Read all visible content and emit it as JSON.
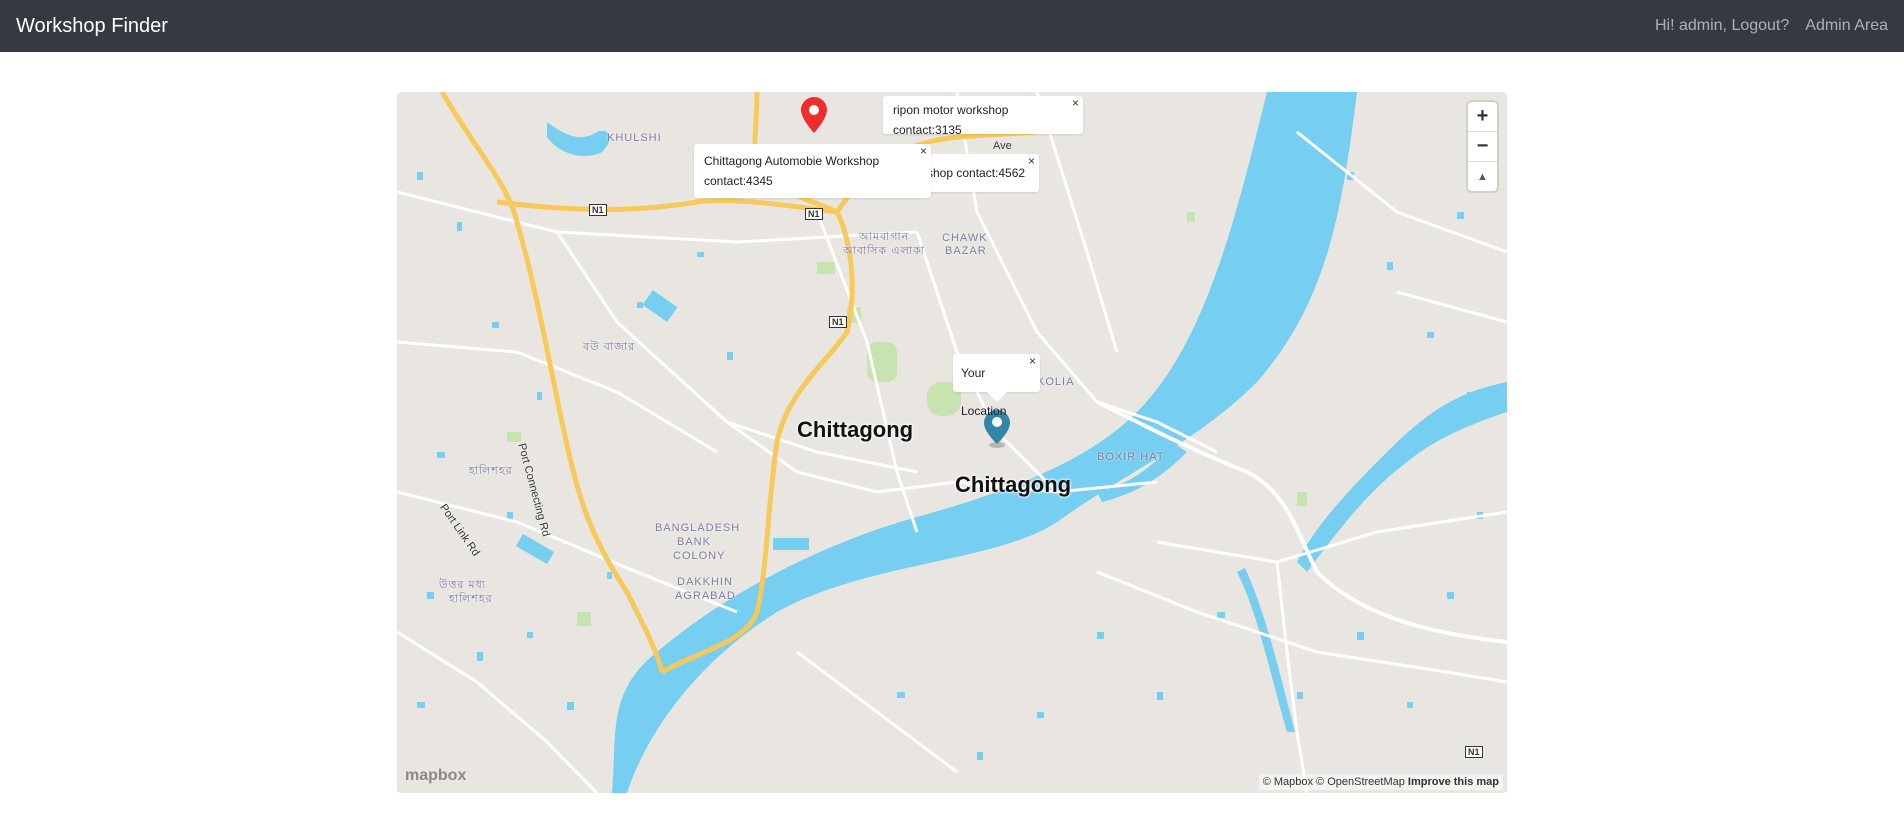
{
  "navbar": {
    "brand": "Workshop Finder",
    "greeting": "Hi! admin, Logout?",
    "admin_link": "Admin Area"
  },
  "map": {
    "controls": {
      "zoom_in": "+",
      "zoom_out": "−",
      "compass": "▲"
    },
    "popups": {
      "ripon": "ripon motor workshop contact:3135",
      "automobile_line1": "Chittagong Automobie Workshop",
      "automobile_line2": "contact:4345",
      "partial": "shop contact:4562",
      "location": "Your Location",
      "close": "×"
    },
    "labels": {
      "city_main": "Chittagong",
      "city_second": "Chittagong",
      "khulshi": "KHULSHI",
      "chawk1": "CHAWK",
      "chawk2": "BAZAR",
      "kolia": "KOLIA",
      "boxir": "BOXIR HAT",
      "bank1": "BANGLADESH",
      "bank2": "BANK",
      "bank3": "COLONY",
      "dakkhin1": "DAKKHIN",
      "dakkhin2": "AGRABAD",
      "bn1": "আমবাগান",
      "bn2": "আবাসিক এলাকা",
      "bn3": "বউ বাজার",
      "bn4": "হালিশহর",
      "bn5": "উত্তর মধ্য",
      "bn6": "হালিশহর",
      "port_rd": "Port Connecting Rd",
      "port_link": "Port Link Rd",
      "n1": "N1",
      "ave": "Ave"
    },
    "logo": "mapbox",
    "attribution": "© Mapbox © OpenStreetMap",
    "improve": "Improve this map"
  },
  "colors": {
    "water": "#76cef0",
    "land": "#e9e6e1",
    "road_major": "#f6c95a",
    "navbar": "#343a40",
    "marker_red": "#ee2d2d",
    "marker_teal": "#3386a8"
  }
}
